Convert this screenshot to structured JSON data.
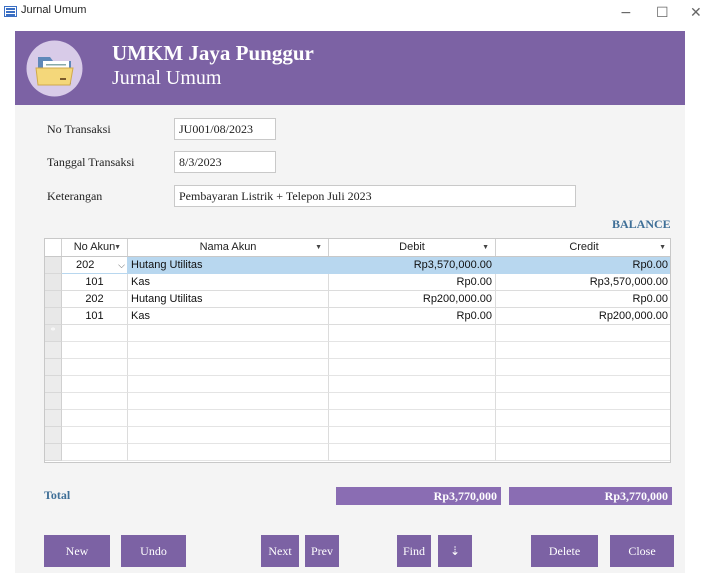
{
  "window": {
    "title": "Jurnal Umum",
    "minimize": "−",
    "maximize": "☐",
    "close": "✕"
  },
  "header": {
    "company": "UMKM Jaya Punggur",
    "form_name": "Jurnal Umum"
  },
  "form": {
    "no_transaksi_label": "No Transaksi",
    "no_transaksi_value": "JU001/08/2023",
    "tanggal_label": "Tanggal Transaksi",
    "tanggal_value": "8/3/2023",
    "keterangan_label": "Keterangan",
    "keterangan_value": "Pembayaran Listrik + Telepon Juli 2023",
    "status": "BALANCE"
  },
  "grid": {
    "columns": [
      "No Akun",
      "Nama Akun",
      "Debit",
      "Credit"
    ],
    "rows": [
      {
        "no_akun": "202",
        "nama_akun": "Hutang Utilitas",
        "debit": "Rp3,570,000.00",
        "credit": "Rp0.00",
        "active": true
      },
      {
        "no_akun": "101",
        "nama_akun": "Kas",
        "debit": "Rp0.00",
        "credit": "Rp3,570,000.00"
      },
      {
        "no_akun": "202",
        "nama_akun": "Hutang Utilitas",
        "debit": "Rp200,000.00",
        "credit": "Rp0.00"
      },
      {
        "no_akun": "101",
        "nama_akun": "Kas",
        "debit": "Rp0.00",
        "credit": "Rp200,000.00"
      }
    ],
    "new_row_marker": "*"
  },
  "totals": {
    "label": "Total",
    "debit": "Rp3,770,000",
    "credit": "Rp3,770,000"
  },
  "buttons": {
    "new": "New",
    "undo": "Undo",
    "next": "Next",
    "prev": "Prev",
    "find": "Find",
    "sort": "⇣",
    "delete": "Delete",
    "close": "Close"
  },
  "colors": {
    "accent": "#7c62a4",
    "status": "#3f6f97",
    "selection": "#b8d7ef"
  }
}
